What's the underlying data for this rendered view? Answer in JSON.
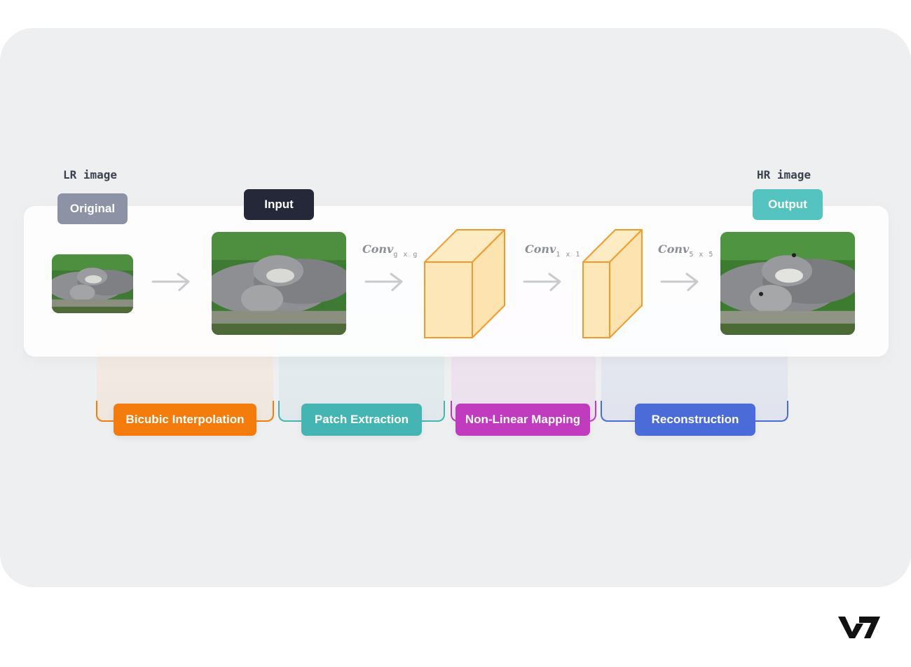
{
  "labels": {
    "lr_image": "LR image",
    "hr_image": "HR image"
  },
  "tags": {
    "original": "Original",
    "input": "Input",
    "output": "Output"
  },
  "convs": [
    {
      "name": "Conv",
      "sub": "g x g"
    },
    {
      "name": "Conv",
      "sub": "1 x 1"
    },
    {
      "name": "Conv",
      "sub": "5 x 5"
    }
  ],
  "stages": [
    {
      "label": "Bicubic Interpolation",
      "color": "#f47c0c"
    },
    {
      "label": "Patch Extraction",
      "color": "#44b5b2"
    },
    {
      "label": "Non-Linear Mapping",
      "color": "#c13bbf"
    },
    {
      "label": "Reconstruction",
      "color": "#4a6bd8"
    }
  ],
  "colors": {
    "original_tag": "#8d93a5",
    "input_tag": "#242838",
    "output_tag": "#55c4c1",
    "cube_fill": "#fde6b8",
    "cube_stroke": "#f39a2c"
  },
  "logo": "V7"
}
